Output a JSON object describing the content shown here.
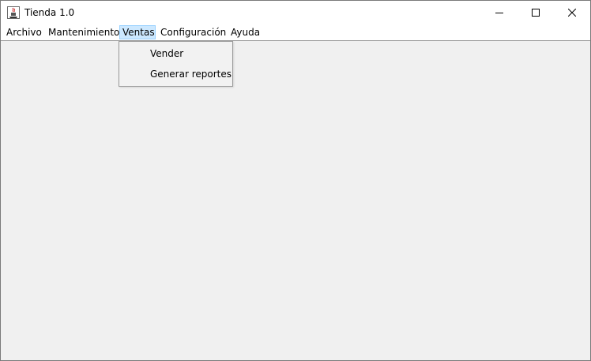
{
  "window": {
    "title": "Tienda 1.0",
    "icon": "java-cup-icon",
    "controls": [
      "minimize",
      "maximize",
      "close"
    ]
  },
  "menubar": {
    "items": [
      {
        "label": "Archivo"
      },
      {
        "label": "Mantenimiento"
      },
      {
        "label": "Ventas",
        "state": "open"
      },
      {
        "label": "Configuración"
      },
      {
        "label": "Ayuda"
      }
    ]
  },
  "dropdown": {
    "parent": "Ventas",
    "items": [
      {
        "label": "Vender"
      },
      {
        "label": "Generar reportes"
      }
    ]
  },
  "colors": {
    "titlebar": "#ffffff",
    "content_bg": "#f0f0f0",
    "menu_highlight": "#cce8ff",
    "menu_highlight_border": "#99d1ff"
  }
}
